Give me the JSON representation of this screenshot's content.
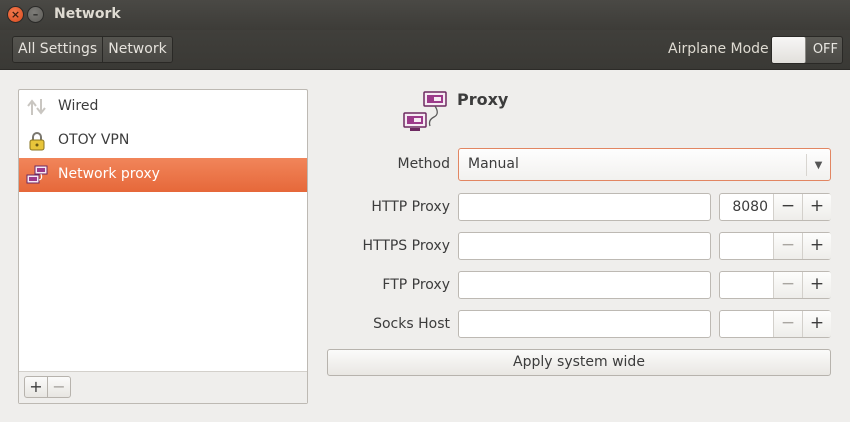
{
  "window": {
    "title": "Network",
    "close_glyph": "×",
    "minimize_glyph": "–"
  },
  "toolbar": {
    "breadcrumbs": [
      "All Settings",
      "Network"
    ],
    "airplane_mode_label": "Airplane Mode",
    "airplane_mode_state": "OFF"
  },
  "sidebar": {
    "items": [
      {
        "label": "Wired",
        "icon": "wired-arrows-icon",
        "selected": false
      },
      {
        "label": "OTOY VPN",
        "icon": "vpn-lock-icon",
        "selected": true
      },
      {
        "label": "Network proxy",
        "icon": "network-proxy-icon",
        "selected": true
      }
    ],
    "add_label": "+",
    "remove_label": "−"
  },
  "proxy": {
    "title": "Proxy",
    "method_label": "Method",
    "method_value": "Manual",
    "rows": [
      {
        "label": "HTTP Proxy",
        "host": "",
        "port": "8080"
      },
      {
        "label": "HTTPS Proxy",
        "host": "",
        "port": ""
      },
      {
        "label": "FTP Proxy",
        "host": "",
        "port": ""
      },
      {
        "label": "Socks Host",
        "host": "",
        "port": ""
      }
    ],
    "minus_label": "−",
    "plus_label": "+",
    "apply_label": "Apply system wide"
  },
  "colors": {
    "accent": "#e9703f",
    "titlebar": "#3d3c38"
  }
}
